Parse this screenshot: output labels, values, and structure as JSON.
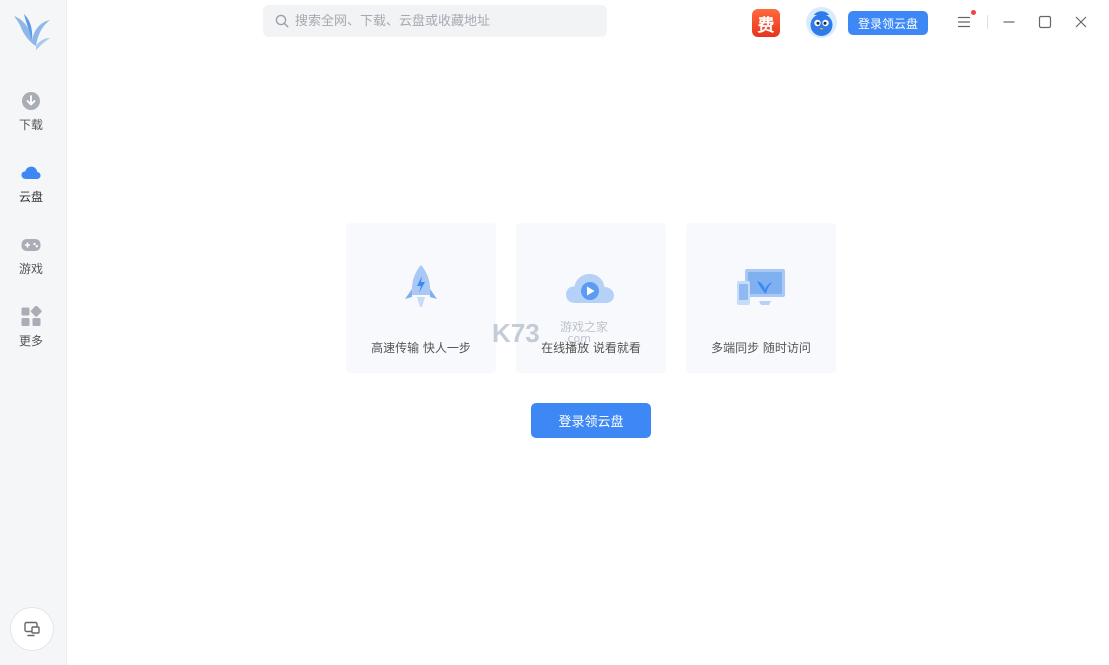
{
  "sidebar": {
    "items": [
      {
        "label": "下载",
        "icon": "download-icon"
      },
      {
        "label": "云盘",
        "icon": "cloud-icon"
      },
      {
        "label": "游戏",
        "icon": "gamepad-icon"
      },
      {
        "label": "更多",
        "icon": "apps-icon"
      }
    ],
    "bottom_icon": "screen-cast-icon"
  },
  "header": {
    "search_placeholder": "搜索全网、下载、云盘或收藏地址",
    "fee_badge": "费",
    "login_label": "登录领云盘"
  },
  "features": [
    {
      "label": "高速传输 快人一步",
      "icon": "rocket-icon"
    },
    {
      "label": "在线播放 说看就看",
      "icon": "cloud-play-icon"
    },
    {
      "label": "多端同步 随时访问",
      "icon": "devices-sync-icon"
    }
  ],
  "main": {
    "login_label": "登录领云盘"
  },
  "watermark": {
    "brand": "K73",
    "cn": "游戏之家",
    "domain": ".com"
  },
  "colors": {
    "accent": "#3d88f5",
    "sidebar_bg": "#f5f6f8",
    "card_bg": "#f7f9fc",
    "badge": "#e8331e"
  }
}
